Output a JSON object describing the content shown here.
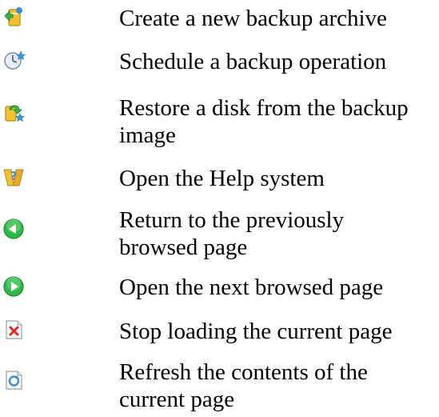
{
  "items": [
    {
      "icon": "backup-archive-icon",
      "lines": [
        "Create a new backup archive"
      ]
    },
    {
      "icon": "schedule-icon",
      "lines": [
        "Schedule a backup operation"
      ]
    },
    {
      "icon": "restore-disk-icon",
      "lines": [
        "Restore a disk from the backup",
        "image"
      ]
    },
    {
      "icon": "help-icon",
      "lines": [
        "Open the Help system"
      ]
    },
    {
      "icon": "back-arrow-icon",
      "lines": [
        "Return to the previously",
        "browsed page"
      ]
    },
    {
      "icon": "forward-arrow-icon",
      "lines": [
        "Open the next browsed page"
      ]
    },
    {
      "icon": "stop-icon",
      "lines": [
        "Stop loading the current page"
      ]
    },
    {
      "icon": "refresh-icon",
      "lines": [
        "Refresh the contents of the",
        "current page"
      ]
    }
  ],
  "colors": {
    "green": "#2fb84a",
    "yellow": "#f2c12e",
    "blue": "#3a8fd8",
    "red": "#e02828"
  }
}
